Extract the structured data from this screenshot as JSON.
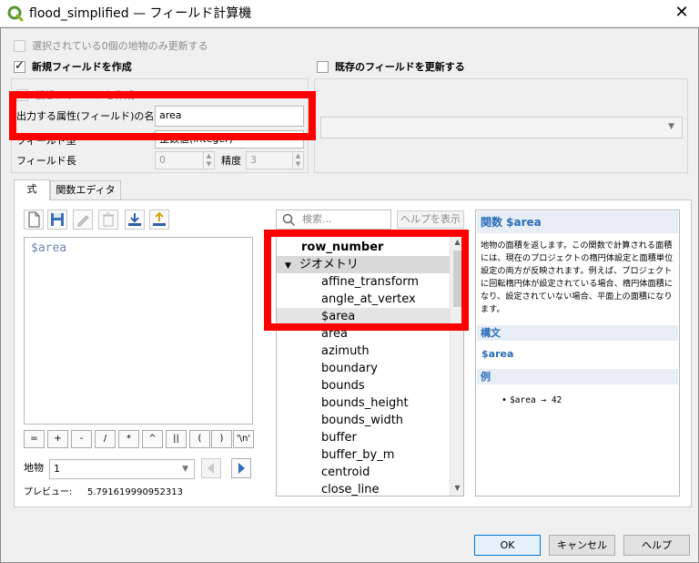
{
  "window": {
    "title": "flood_simplified — フィールド計算機",
    "close_glyph": "✕"
  },
  "top": {
    "update_selected_label": "選択されている0個の地物のみ更新する",
    "create_new_field": {
      "label": "新規フィールドを作成",
      "checked": true,
      "virtual_field_label": "仮想フィールドを作成",
      "output_name_label": "出力する属性(フィールド)の名前",
      "output_name_value": "area",
      "field_type_label": "フィールド型",
      "field_type_value": "整数値(integer)",
      "field_length_label": "フィールド長",
      "field_length_value": "0",
      "precision_label": "精度",
      "precision_value": "3"
    },
    "update_existing": {
      "label": "既存のフィールドを更新する",
      "checked": false
    }
  },
  "tabs": [
    {
      "label": "式",
      "active": true
    },
    {
      "label": "関数エディタ",
      "active": false
    }
  ],
  "toolbar": {
    "icons": [
      "new-file-icon",
      "save-icon",
      "edit-icon",
      "delete-icon",
      "load-icon",
      "export-icon"
    ]
  },
  "editor": {
    "expression": "$area"
  },
  "operators": [
    "=",
    "+",
    "-",
    "/",
    "*",
    "^",
    "||",
    "(",
    ")",
    "'\\n'"
  ],
  "feature": {
    "label": "地物",
    "value": "1"
  },
  "preview": {
    "label": "プレビュー:",
    "value": "5.791619990952313"
  },
  "function_list": {
    "search_placeholder": "検索...",
    "show_help_label": "ヘルプを表示",
    "items": [
      {
        "text": "row_number",
        "level": 0,
        "bold": true
      },
      {
        "text": "ジオメトリ",
        "level": 0,
        "group": true
      },
      {
        "text": "affine_transform",
        "level": 1
      },
      {
        "text": "angle_at_vertex",
        "level": 1
      },
      {
        "text": "$area",
        "level": 1,
        "selected": true
      },
      {
        "text": "area",
        "level": 1
      },
      {
        "text": "azimuth",
        "level": 1
      },
      {
        "text": "boundary",
        "level": 1
      },
      {
        "text": "bounds",
        "level": 1
      },
      {
        "text": "bounds_height",
        "level": 1
      },
      {
        "text": "bounds_width",
        "level": 1
      },
      {
        "text": "buffer",
        "level": 1
      },
      {
        "text": "buffer_by_m",
        "level": 1
      },
      {
        "text": "centroid",
        "level": 1
      },
      {
        "text": "close_line",
        "level": 1
      }
    ]
  },
  "help": {
    "title": "関数 $area",
    "description": "地物の面積を返します。この関数で計算される面積には、現在のプロジェクトの楕円体設定と面積単位設定の両方が反映されます。例えば、プロジェクトに回転楕円体が設定されている場合、楕円体面積になり、設定されていない場合、平面上の面積になります。",
    "syntax_header": "構文",
    "syntax": "$area",
    "examples_header": "例",
    "example": "$area → 42"
  },
  "buttons": {
    "ok": "OK",
    "cancel": "キャンセル",
    "help": "ヘルプ"
  },
  "colors": {
    "highlight_red": "#ff0000",
    "help_accent": "#2a6db8",
    "selected_row": "#e5e5e5",
    "group_row": "#d9d9d9"
  }
}
